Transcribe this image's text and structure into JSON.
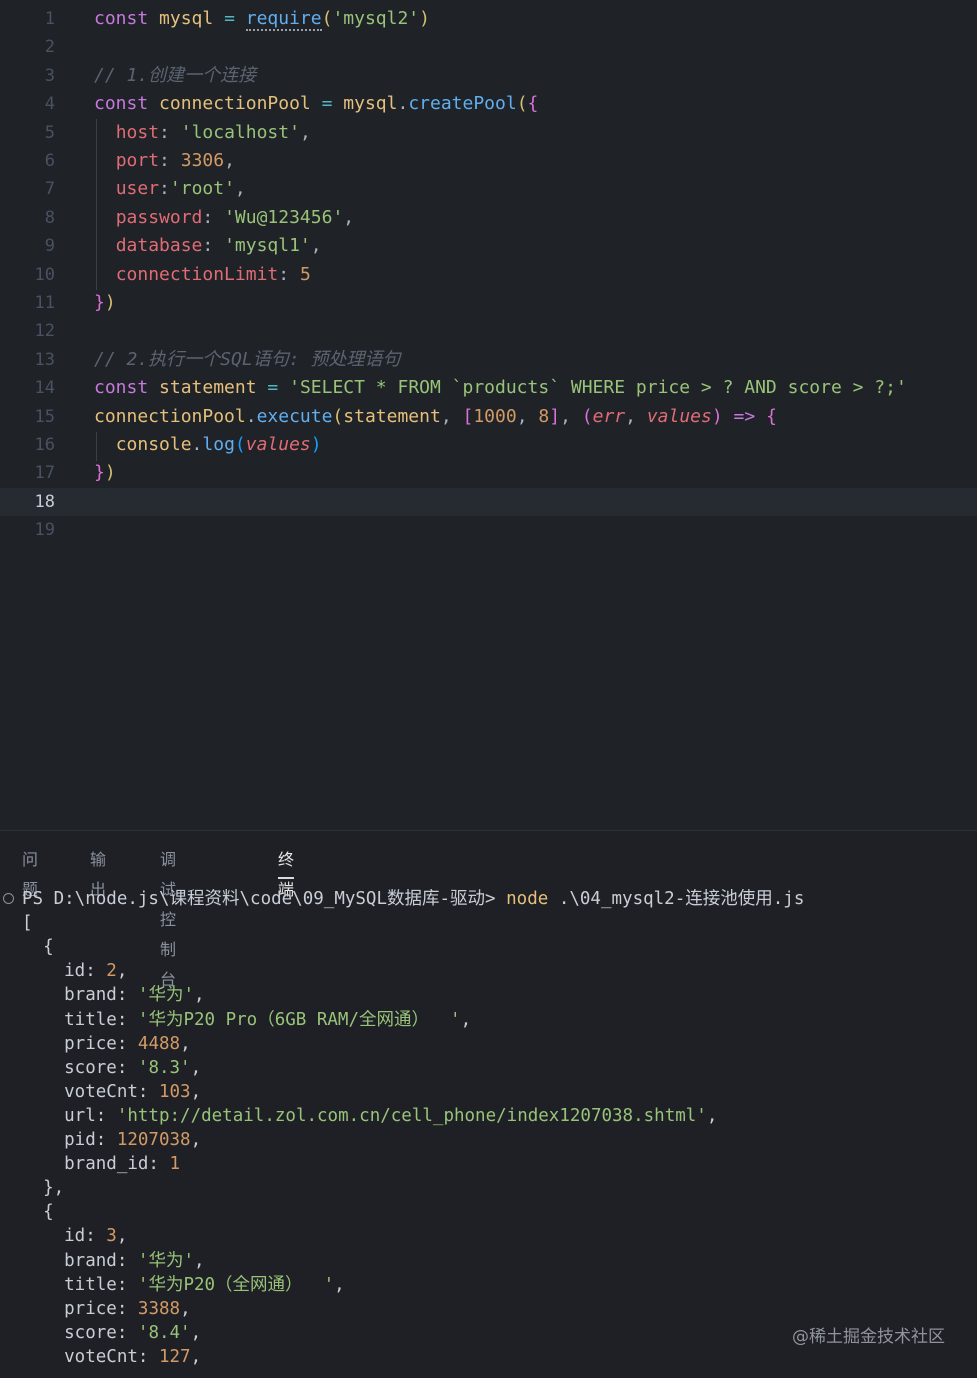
{
  "editor": {
    "lines": [
      {
        "n": "1",
        "tokens": [
          [
            "kw",
            "const"
          ],
          [
            "pun",
            " "
          ],
          [
            "var",
            "mysql"
          ],
          [
            "pun",
            " "
          ],
          [
            "op",
            "="
          ],
          [
            "pun",
            " "
          ],
          [
            "req",
            "require"
          ],
          [
            "br1",
            "("
          ],
          [
            "str",
            "'mysql2'"
          ],
          [
            "br1",
            ")"
          ]
        ]
      },
      {
        "n": "2",
        "tokens": []
      },
      {
        "n": "3",
        "tokens": [
          [
            "cm",
            "// 1.创建一个连接"
          ]
        ]
      },
      {
        "n": "4",
        "tokens": [
          [
            "kw",
            "const"
          ],
          [
            "pun",
            " "
          ],
          [
            "var",
            "connectionPool"
          ],
          [
            "pun",
            " "
          ],
          [
            "op",
            "="
          ],
          [
            "pun",
            " "
          ],
          [
            "var",
            "mysql"
          ],
          [
            "pun",
            "."
          ],
          [
            "fn",
            "createPool"
          ],
          [
            "br1",
            "("
          ],
          [
            "br2",
            "{"
          ]
        ]
      },
      {
        "n": "5",
        "tokens": [
          [
            "pun",
            "  "
          ],
          [
            "prop",
            "host"
          ],
          [
            "pun",
            ": "
          ],
          [
            "str",
            "'localhost'"
          ],
          [
            "pun",
            ","
          ]
        ]
      },
      {
        "n": "6",
        "tokens": [
          [
            "pun",
            "  "
          ],
          [
            "prop",
            "port"
          ],
          [
            "pun",
            ": "
          ],
          [
            "num",
            "3306"
          ],
          [
            "pun",
            ","
          ]
        ]
      },
      {
        "n": "7",
        "tokens": [
          [
            "pun",
            "  "
          ],
          [
            "prop",
            "user"
          ],
          [
            "pun",
            ":"
          ],
          [
            "str",
            "'root'"
          ],
          [
            "pun",
            ","
          ]
        ]
      },
      {
        "n": "8",
        "tokens": [
          [
            "pun",
            "  "
          ],
          [
            "prop",
            "password"
          ],
          [
            "pun",
            ": "
          ],
          [
            "str",
            "'Wu@123456'"
          ],
          [
            "pun",
            ","
          ]
        ]
      },
      {
        "n": "9",
        "tokens": [
          [
            "pun",
            "  "
          ],
          [
            "prop",
            "database"
          ],
          [
            "pun",
            ": "
          ],
          [
            "str",
            "'mysql1'"
          ],
          [
            "pun",
            ","
          ]
        ]
      },
      {
        "n": "10",
        "tokens": [
          [
            "pun",
            "  "
          ],
          [
            "prop",
            "connectionLimit"
          ],
          [
            "pun",
            ": "
          ],
          [
            "num",
            "5"
          ]
        ]
      },
      {
        "n": "11",
        "tokens": [
          [
            "br2",
            "}"
          ],
          [
            "br1",
            ")"
          ]
        ]
      },
      {
        "n": "12",
        "tokens": []
      },
      {
        "n": "13",
        "tokens": [
          [
            "cm",
            "// 2.执行一个SQL语句: 预处理语句"
          ]
        ]
      },
      {
        "n": "14",
        "tokens": [
          [
            "kw",
            "const"
          ],
          [
            "pun",
            " "
          ],
          [
            "var",
            "statement"
          ],
          [
            "pun",
            " "
          ],
          [
            "op",
            "="
          ],
          [
            "pun",
            " "
          ],
          [
            "str",
            "'SELECT * FROM `products` WHERE price > ? AND score > ?;'"
          ]
        ]
      },
      {
        "n": "15",
        "tokens": [
          [
            "var",
            "connectionPool"
          ],
          [
            "pun",
            "."
          ],
          [
            "fn",
            "execute"
          ],
          [
            "br1",
            "("
          ],
          [
            "var",
            "statement"
          ],
          [
            "pun",
            ", "
          ],
          [
            "br2",
            "["
          ],
          [
            "num",
            "1000"
          ],
          [
            "pun",
            ", "
          ],
          [
            "num",
            "8"
          ],
          [
            "br2",
            "]"
          ],
          [
            "pun",
            ", "
          ],
          [
            "br2",
            "("
          ],
          [
            "prm",
            "err"
          ],
          [
            "pun",
            ", "
          ],
          [
            "prm",
            "values"
          ],
          [
            "br2",
            ")"
          ],
          [
            "pun",
            " "
          ],
          [
            "kw",
            "=>"
          ],
          [
            "pun",
            " "
          ],
          [
            "br2",
            "{"
          ]
        ]
      },
      {
        "n": "16",
        "tokens": [
          [
            "pun",
            "  "
          ],
          [
            "var",
            "console"
          ],
          [
            "pun",
            "."
          ],
          [
            "fn",
            "log"
          ],
          [
            "br3",
            "("
          ],
          [
            "prm",
            "values"
          ],
          [
            "br3",
            ")"
          ]
        ]
      },
      {
        "n": "17",
        "tokens": [
          [
            "br2",
            "}"
          ],
          [
            "br1",
            ")"
          ]
        ]
      },
      {
        "n": "18",
        "tokens": [],
        "current": true
      },
      {
        "n": "19",
        "tokens": []
      }
    ]
  },
  "panel": {
    "tabs": [
      {
        "label": "问题",
        "active": false
      },
      {
        "label": "输出",
        "active": false
      },
      {
        "label": "调试控制台",
        "active": false
      },
      {
        "label": "终端",
        "active": true
      }
    ]
  },
  "terminal": {
    "lines": [
      [
        [
          "tkey",
          "PS D:\\node.js\\课程资料\\code\\09_MySQL数据库-驱动> "
        ],
        [
          "tcmd",
          "node"
        ],
        [
          "tkey",
          " .\\04_mysql2-连接池使用.js"
        ]
      ],
      [
        [
          "tkey",
          "["
        ]
      ],
      [
        [
          "tkey",
          "  {"
        ]
      ],
      [
        [
          "tkey",
          "    id: "
        ],
        [
          "tnum",
          "2"
        ],
        [
          "tkey",
          ","
        ]
      ],
      [
        [
          "tkey",
          "    brand: "
        ],
        [
          "tstr",
          "'华为'"
        ],
        [
          "tkey",
          ","
        ]
      ],
      [
        [
          "tkey",
          "    title: "
        ],
        [
          "tstr",
          "'华为P20 Pro（6GB RAM/全网通）  '"
        ],
        [
          "tkey",
          ","
        ]
      ],
      [
        [
          "tkey",
          "    price: "
        ],
        [
          "tnum",
          "4488"
        ],
        [
          "tkey",
          ","
        ]
      ],
      [
        [
          "tkey",
          "    score: "
        ],
        [
          "tstr",
          "'8.3'"
        ],
        [
          "tkey",
          ","
        ]
      ],
      [
        [
          "tkey",
          "    voteCnt: "
        ],
        [
          "tnum",
          "103"
        ],
        [
          "tkey",
          ","
        ]
      ],
      [
        [
          "tkey",
          "    url: "
        ],
        [
          "tstr",
          "'http://detail.zol.com.cn/cell_phone/index1207038.shtml'"
        ],
        [
          "tkey",
          ","
        ]
      ],
      [
        [
          "tkey",
          "    pid: "
        ],
        [
          "tnum",
          "1207038"
        ],
        [
          "tkey",
          ","
        ]
      ],
      [
        [
          "tkey",
          "    brand_id: "
        ],
        [
          "tnum",
          "1"
        ]
      ],
      [
        [
          "tkey",
          "  },"
        ]
      ],
      [
        [
          "tkey",
          "  {"
        ]
      ],
      [
        [
          "tkey",
          "    id: "
        ],
        [
          "tnum",
          "3"
        ],
        [
          "tkey",
          ","
        ]
      ],
      [
        [
          "tkey",
          "    brand: "
        ],
        [
          "tstr",
          "'华为'"
        ],
        [
          "tkey",
          ","
        ]
      ],
      [
        [
          "tkey",
          "    title: "
        ],
        [
          "tstr",
          "'华为P20（全网通）  '"
        ],
        [
          "tkey",
          ","
        ]
      ],
      [
        [
          "tkey",
          "    price: "
        ],
        [
          "tnum",
          "3388"
        ],
        [
          "tkey",
          ","
        ]
      ],
      [
        [
          "tkey",
          "    score: "
        ],
        [
          "tstr",
          "'8.4'"
        ],
        [
          "tkey",
          ","
        ]
      ],
      [
        [
          "tkey",
          "    voteCnt: "
        ],
        [
          "tnum",
          "127"
        ],
        [
          "tkey",
          ","
        ]
      ]
    ]
  },
  "watermark": "@稀土掘金技术社区"
}
